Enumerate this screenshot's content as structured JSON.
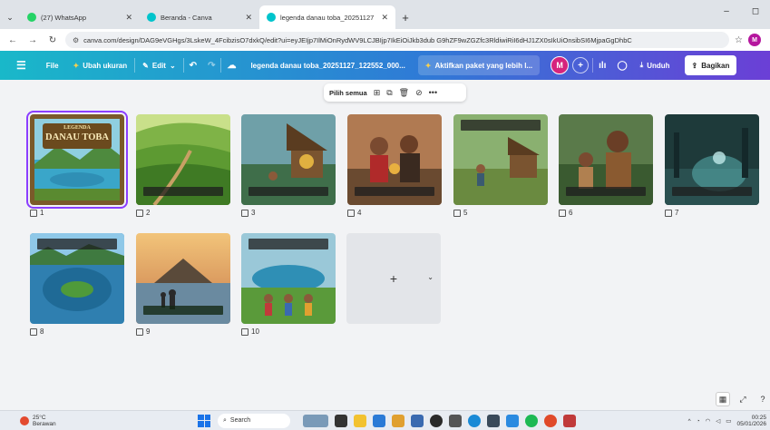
{
  "browser": {
    "tabs": [
      {
        "title": "(27) WhatsApp",
        "color": "#25d366",
        "active": false
      },
      {
        "title": "Beranda - Canva",
        "color": "#00c4cc",
        "active": false
      },
      {
        "title": "legenda danau toba_20251127",
        "color": "#00c4cc",
        "active": true
      }
    ],
    "url": "canva.com/design/DAG9eVGHgs/3LskeW_4FcibzisO7dxkQ/edit?ui=eyJEIjp7IlMiOnRydWV9LCJBIjp7IkEiOiJkb3dub G9hZF9wZGZfc3RldiwiRiI6dHJ1ZX0sIkUiOnsibSI6MjpaGgDhbC",
    "profile_letter": "M"
  },
  "canva": {
    "file_label": "File",
    "resize_label": "Ubah ukuran",
    "edit_label": "Edit",
    "title": "legenda danau toba_20251127_122552_000...",
    "promo_label": "Aktifkan paket yang lebih l...",
    "avatar_letter": "M",
    "plus_label": "+",
    "download_label": "Unduh",
    "share_label": "Bagikan"
  },
  "selection_toolbar": {
    "select_all_label": "Pilih semua"
  },
  "pages": [
    {
      "number": "1",
      "selected": true,
      "scene": "title",
      "title_line1": "LEGENDA",
      "title_line2": "DANAU TOBA"
    },
    {
      "number": "2",
      "selected": false,
      "scene": "terraces"
    },
    {
      "number": "3",
      "selected": false,
      "scene": "hut"
    },
    {
      "number": "4",
      "selected": false,
      "scene": "couple"
    },
    {
      "number": "5",
      "selected": false,
      "scene": "village"
    },
    {
      "number": "6",
      "selected": false,
      "scene": "father"
    },
    {
      "number": "7",
      "selected": false,
      "scene": "night"
    },
    {
      "number": "8",
      "selected": false,
      "scene": "island"
    },
    {
      "number": "9",
      "selected": false,
      "scene": "sunset"
    },
    {
      "number": "10",
      "selected": false,
      "scene": "kids"
    }
  ],
  "add_page": {
    "plus": "+",
    "chevron": "⌄"
  },
  "taskbar": {
    "temp": "25°C",
    "weather": "Berawan",
    "search": "Search",
    "time": "00:25",
    "date": "05/01/2026"
  }
}
